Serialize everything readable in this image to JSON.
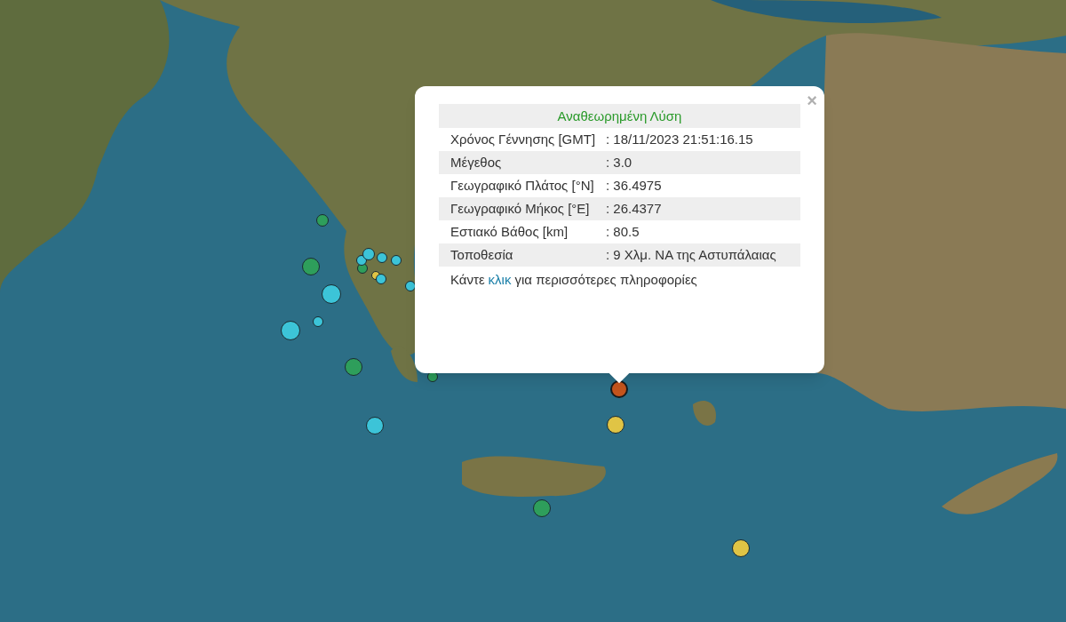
{
  "map": {
    "markers": [
      {
        "color": "#2e9e5b",
        "selected": false
      },
      {
        "color": "#2e9e5b",
        "selected": false
      },
      {
        "color": "#3cc4d8",
        "selected": false
      },
      {
        "color": "#3cc4d8",
        "selected": false
      },
      {
        "color": "#3cc4d8",
        "selected": false
      },
      {
        "color": "#2e9e5b",
        "selected": false
      },
      {
        "color": "#3cc4d8",
        "selected": false
      },
      {
        "color": "#2e9e5b",
        "selected": false
      },
      {
        "color": "#3cc4d8",
        "selected": false
      },
      {
        "color": "#3cc4d8",
        "selected": false
      },
      {
        "color": "#3cc4d8",
        "selected": false
      },
      {
        "color": "#3cc4d8",
        "selected": false
      },
      {
        "color": "#e0c445",
        "selected": false
      },
      {
        "color": "#3cc4d8",
        "selected": false
      },
      {
        "color": "#3cc4d8",
        "selected": false
      },
      {
        "color": "#2e9e5b",
        "selected": false
      },
      {
        "color": "#c4541c",
        "selected": true
      },
      {
        "color": "#e0c445",
        "selected": false
      },
      {
        "color": "#2e9e5b",
        "selected": false
      },
      {
        "color": "#e0c445",
        "selected": false
      }
    ]
  },
  "popup": {
    "close": "×",
    "title": "Αναθεωρημένη Λύση",
    "rows": [
      {
        "label": "Χρόνος Γέννησης [GMT]",
        "value": ": 18/11/2023 21:51:16.15"
      },
      {
        "label": "Μέγεθος",
        "value": ": 3.0"
      },
      {
        "label": "Γεωγραφικό Πλάτος [°N]",
        "value": ": 36.4975"
      },
      {
        "label": "Γεωγραφικό Μήκος [°E]",
        "value": ": 26.4377"
      },
      {
        "label": "Εστιακό Βάθος [km]",
        "value": ": 80.5"
      },
      {
        "label": "Τοποθεσία",
        "value": ": 9 Χλμ. ΝΑ της Αστυπάλαιας"
      }
    ],
    "footer": {
      "before": "Κάντε",
      "link": "κλικ",
      "after": "για περισσότερες πληροφορίες"
    }
  }
}
